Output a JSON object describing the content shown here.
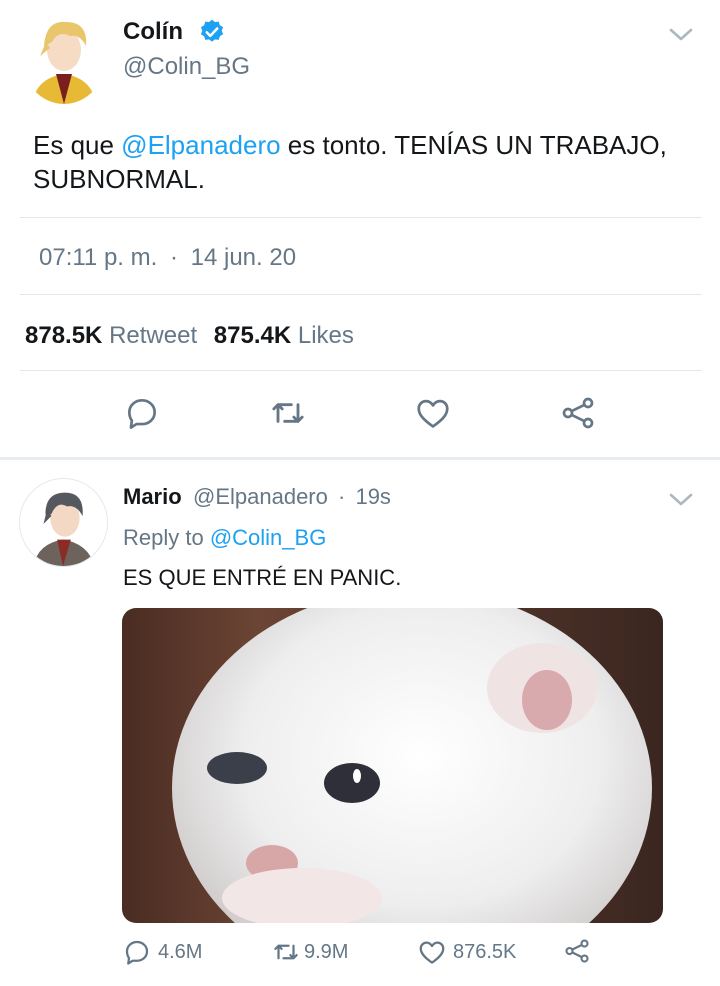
{
  "tweet": {
    "author_name": "Colín",
    "author_handle": "@Colin_BG",
    "text_before": "Es que ",
    "mention": "@Elpanadero",
    "text_after": " es tonto. TENÍAS UN TRABAJO, SUBNORMAL.",
    "time": "07:11 p. m.",
    "separator": "·",
    "date": "14 jun. 20",
    "retweet_count": "878.5K",
    "retweet_label": "Retweet",
    "like_count": "875.4K",
    "like_label": "Likes"
  },
  "reply": {
    "author_name": "Mario",
    "author_handle": "@Elpanadero",
    "separator": "·",
    "age": "19s",
    "reply_prefix": "Reply to ",
    "reply_target": "@Colin_BG",
    "text": "ES QUE ENTRÉ EN PANIC.",
    "reply_count": "4.6M",
    "retweet_count": "9.9M",
    "like_count": "876.5K"
  },
  "colors": {
    "accent": "#1da1f2",
    "verified": "#1da1f2",
    "secondary_text": "#657786"
  },
  "icons": [
    "verified-badge-icon",
    "chevron-down-icon",
    "reply-icon",
    "retweet-icon",
    "like-icon",
    "share-icon"
  ]
}
